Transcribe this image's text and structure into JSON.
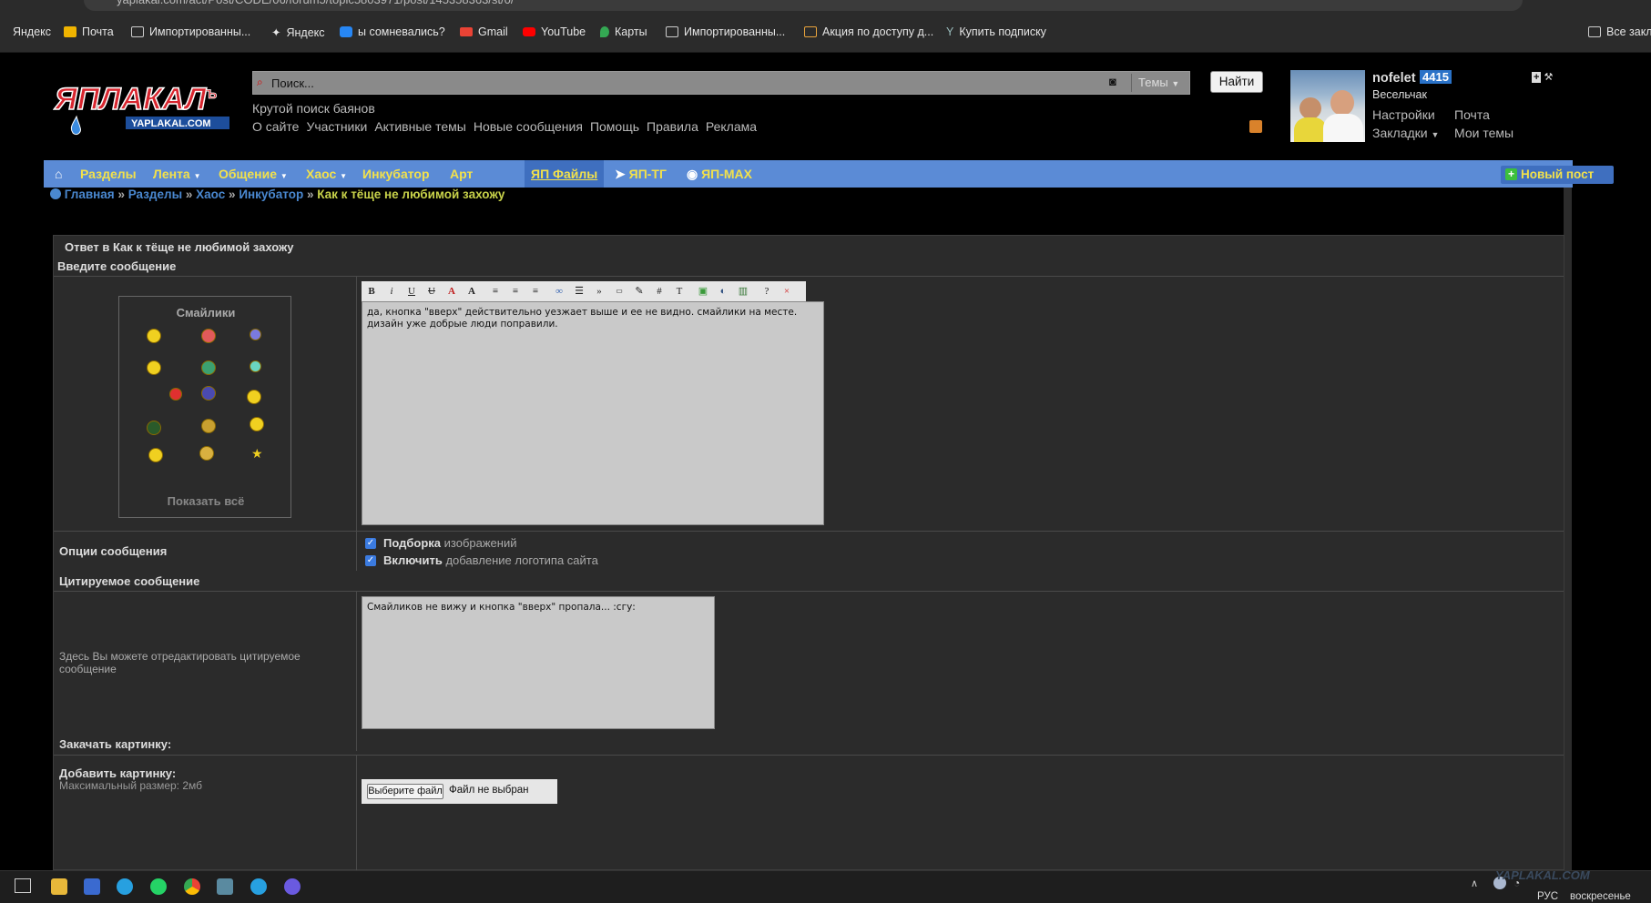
{
  "browser": {
    "url": "yaplakal.com/act/Post/CODE/06/forum5/topic5803971/post/145358363/st/0/",
    "bookmarks": [
      {
        "label": "Яндекс",
        "icon": "yandex-icon"
      },
      {
        "label": "Почта",
        "icon": "mail-icon"
      },
      {
        "label": "Импортированны...",
        "icon": "folder-icon"
      },
      {
        "label": "Яндекс",
        "icon": "yandex-star-icon"
      },
      {
        "label": "ы сомневались?",
        "icon": "vk-icon"
      },
      {
        "label": "Gmail",
        "icon": "gmail-icon"
      },
      {
        "label": "YouTube",
        "icon": "youtube-icon"
      },
      {
        "label": "Карты",
        "icon": "maps-icon"
      },
      {
        "label": "Импортированны...",
        "icon": "folder-icon"
      },
      {
        "label": "Акция по доступу д...",
        "icon": "promo-icon"
      },
      {
        "label": "Купить подписку",
        "icon": "subscription-icon"
      },
      {
        "label": "Все закл",
        "icon": "folder-icon"
      }
    ]
  },
  "header": {
    "search_placeholder": "Поиск...",
    "search_scope": "Темы",
    "find_button": "Найти",
    "tagline": "Крутой поиск баянов",
    "links": [
      "О сайте",
      "Участники",
      "Активные темы",
      "Новые сообщения",
      "Помощь",
      "Правила",
      "Реклама"
    ]
  },
  "user": {
    "name": "nofelet",
    "karma": "4415",
    "rank": "Весельчак",
    "links": {
      "settings": "Настройки",
      "mail": "Почта",
      "bookmarks": "Закладки",
      "my_topics": "Мои темы"
    }
  },
  "nav": {
    "items": [
      "Разделы",
      "Лента",
      "Общение",
      "Хаос",
      "Инкубатор",
      "Арт",
      "ЯП Файлы",
      "ЯП-ТГ",
      "ЯП-MAX"
    ],
    "new_post": "Новый пост"
  },
  "breadcrumb": {
    "items": [
      "Главная",
      "Разделы",
      "Хаос",
      "Инкубатор"
    ],
    "current": "Как к тёще не любимой захожу",
    "separator": "»"
  },
  "form": {
    "title": "Ответ в Как к тёще не любимой захожу",
    "enter_message": "Введите сообщение",
    "smilies_title": "Смайлики",
    "show_all": "Показать всё",
    "message_text": "да, кнопка \"вверх\" действительно уезжает выше и ее не видно. смайлики на месте. дизайн уже добрые люди поправили.",
    "options_label": "Опции сообщения",
    "option1_bold": "Подборка",
    "option1_rest": "изображений",
    "option2_bold": "Включить",
    "option2_rest": "добавление логотипа сайта",
    "quoted_header": "Цитируемое сообщение",
    "quoted_hint": "Здесь Вы можете отредактировать цитируемое сообщение",
    "quoted_text": "Смайликов не вижу и кнопка \"вверх\" пропала... :сгу:",
    "upload_header": "Закачать картинку:",
    "add_image": "Добавить картинку:",
    "max_size": "Максимальный размер: 2мб",
    "choose_file": "Выберите файл",
    "no_file": "Файл не выбран"
  },
  "taskbar": {
    "lang": "РУС",
    "day": "воскресенье",
    "watermark": "YAPLAKAL.COM"
  },
  "colors": {
    "nav_bg": "#5b8bd6",
    "nav_text": "#f2e14b",
    "link_blue": "#4a88d0",
    "breadcrumb_current": "#c8d24a",
    "panel_bg": "#2b2b2b"
  }
}
